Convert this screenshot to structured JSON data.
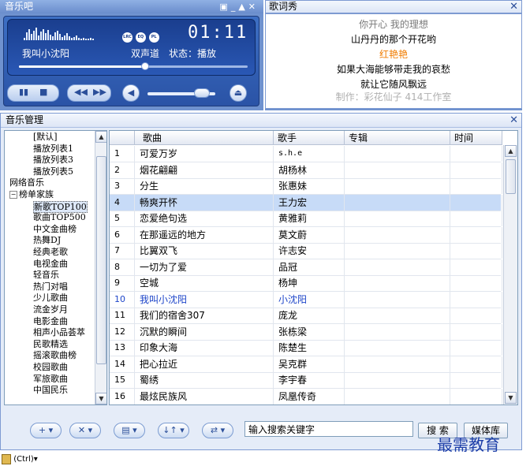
{
  "player": {
    "title": "音乐吧",
    "song": "我叫小沈阳",
    "channel": "双声道",
    "status": "状态：播放",
    "time": "01:11",
    "mode_icons": [
      "LRC",
      "EQ",
      "PL"
    ],
    "window_controls": [
      "▣",
      "_",
      "▲",
      "✕"
    ],
    "progress": 0.55,
    "volume": 0.8
  },
  "lyrics": {
    "title": "歌词秀",
    "lines": [
      {
        "text": "你开心 我的理想",
        "color": "#7a7a7a"
      },
      {
        "text": "山丹丹的那个开花哟",
        "color": "#000000"
      },
      {
        "text": "红艳艳",
        "color": "#f07c00"
      },
      {
        "text": "如果大海能够带走我的哀愁",
        "color": "#000000"
      },
      {
        "text": "就让它随风飘远",
        "color": "#000000"
      },
      {
        "text": "制作：彩花仙子 414工作室",
        "color": "#b0b0b0"
      }
    ]
  },
  "manager": {
    "title": "音乐管理",
    "tree": [
      {
        "label": "[默认]",
        "indent": 2
      },
      {
        "label": "播放列表1",
        "indent": 2
      },
      {
        "label": "播放列表3",
        "indent": 2
      },
      {
        "label": "播放列表5",
        "indent": 2
      },
      {
        "label": "网络音乐",
        "indent": 1
      },
      {
        "label": "榜单家族",
        "indent": 1,
        "expander": "−"
      },
      {
        "label": "新歌TOP100",
        "indent": 2,
        "selected": true
      },
      {
        "label": "歌曲TOP500",
        "indent": 2
      },
      {
        "label": "中文金曲榜",
        "indent": 2
      },
      {
        "label": "热舞DJ",
        "indent": 2
      },
      {
        "label": "经典老歌",
        "indent": 2
      },
      {
        "label": "电视金曲",
        "indent": 2
      },
      {
        "label": "轻音乐",
        "indent": 2
      },
      {
        "label": "热门对唱",
        "indent": 2
      },
      {
        "label": "少儿歌曲",
        "indent": 2
      },
      {
        "label": "流金岁月",
        "indent": 2
      },
      {
        "label": "电影金曲",
        "indent": 2
      },
      {
        "label": "相声小品荟萃",
        "indent": 2
      },
      {
        "label": "民歌精选",
        "indent": 2
      },
      {
        "label": "摇滚歌曲榜",
        "indent": 2
      },
      {
        "label": "校园歌曲",
        "indent": 2
      },
      {
        "label": "军旅歌曲",
        "indent": 2
      },
      {
        "label": "中国民乐",
        "indent": 2
      }
    ],
    "columns": [
      "歌曲",
      "歌手",
      "专辑",
      "时间"
    ],
    "rows": [
      {
        "no": "1",
        "song": "可爱万岁",
        "artist": "s.h.e"
      },
      {
        "no": "2",
        "song": "烟花翩翩",
        "artist": "胡杨林"
      },
      {
        "no": "3",
        "song": "分生",
        "artist": "张惠妹"
      },
      {
        "no": "4",
        "song": "畅爽开怀",
        "artist": "王力宏",
        "selected": true
      },
      {
        "no": "5",
        "song": "恋爱绝句选",
        "artist": "黄雅莉"
      },
      {
        "no": "6",
        "song": "在那遥远的地方",
        "artist": "莫文蔚"
      },
      {
        "no": "7",
        "song": "比翼双飞",
        "artist": "许志安"
      },
      {
        "no": "8",
        "song": "一切为了爱",
        "artist": "品冠"
      },
      {
        "no": "9",
        "song": "空城",
        "artist": "杨坤"
      },
      {
        "no": "10",
        "song": "我叫小沈阳",
        "artist": "小沈阳",
        "playing": true
      },
      {
        "no": "11",
        "song": "我们的宿舍307",
        "artist": "庞龙"
      },
      {
        "no": "12",
        "song": "沉默的瞬间",
        "artist": "张栋梁"
      },
      {
        "no": "13",
        "song": "印象大海",
        "artist": "陈楚生"
      },
      {
        "no": "14",
        "song": "把心拉近",
        "artist": "吴克群"
      },
      {
        "no": "15",
        "song": "蜀绣",
        "artist": "李宇春"
      },
      {
        "no": "16",
        "song": "最炫民族风",
        "artist": "凤凰传奇"
      }
    ],
    "bottom_buttons": [
      "+",
      "✕",
      "▤",
      "↓↑",
      "⇄"
    ],
    "search_placeholder": "输入搜索关键字",
    "search_button": "搜 索",
    "media_button": "媒体库"
  },
  "taskbar": {
    "label": "Ctrl"
  },
  "watermark": "最需教育"
}
